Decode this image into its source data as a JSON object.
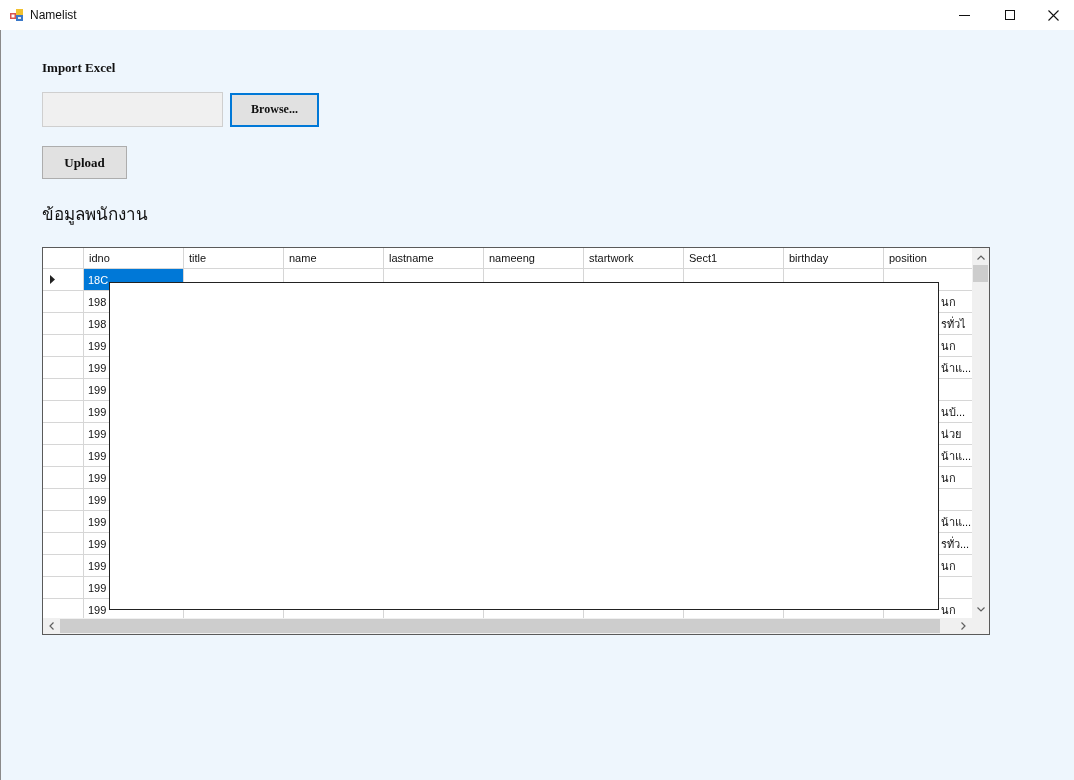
{
  "window": {
    "title": "Namelist"
  },
  "form": {
    "label": "Import Excel",
    "browse_button": {
      "label": "Browse...",
      "focused": true
    },
    "upload_button": "Upload",
    "section_title": "ข้อมูลพนักงาน"
  },
  "table": {
    "columns": [
      "idno",
      "title",
      "name",
      "lastname",
      "nameeng",
      "startwork",
      "Sect1",
      "birthday",
      "position"
    ],
    "rows": [
      {
        "selected": true,
        "cells": [
          "18C",
          null,
          null,
          null,
          null,
          null,
          null,
          null,
          null
        ]
      },
      {
        "selected": false,
        "cells": [
          "198",
          null,
          null,
          null,
          null,
          null,
          null,
          null,
          "นก"
        ]
      },
      {
        "selected": false,
        "cells": [
          "198",
          null,
          null,
          null,
          null,
          null,
          null,
          null,
          "รทั่วไ"
        ]
      },
      {
        "selected": false,
        "cells": [
          "199",
          null,
          null,
          null,
          null,
          null,
          null,
          null,
          "นก"
        ]
      },
      {
        "selected": false,
        "cells": [
          "199",
          null,
          null,
          null,
          null,
          null,
          null,
          null,
          "น้าแ..."
        ]
      },
      {
        "selected": false,
        "cells": [
          "199",
          null,
          null,
          null,
          null,
          null,
          null,
          null,
          null
        ]
      },
      {
        "selected": false,
        "cells": [
          "199",
          null,
          null,
          null,
          null,
          null,
          null,
          null,
          "นบ้..."
        ]
      },
      {
        "selected": false,
        "cells": [
          "199",
          null,
          null,
          null,
          null,
          null,
          null,
          null,
          "น่วย"
        ]
      },
      {
        "selected": false,
        "cells": [
          "199",
          null,
          null,
          null,
          null,
          null,
          null,
          null,
          "น้าแ..."
        ]
      },
      {
        "selected": false,
        "cells": [
          "199",
          null,
          null,
          null,
          null,
          null,
          null,
          null,
          "นก"
        ]
      },
      {
        "selected": false,
        "cells": [
          "199",
          null,
          null,
          null,
          null,
          null,
          null,
          null,
          null
        ]
      },
      {
        "selected": false,
        "cells": [
          "199",
          null,
          null,
          null,
          null,
          null,
          null,
          null,
          "น้าแ..."
        ]
      },
      {
        "selected": false,
        "cells": [
          "199",
          null,
          null,
          null,
          null,
          null,
          null,
          null,
          "รทั่ว..."
        ]
      },
      {
        "selected": false,
        "cells": [
          "199",
          null,
          null,
          null,
          null,
          null,
          null,
          null,
          "นก"
        ]
      },
      {
        "selected": false,
        "cells": [
          "199",
          null,
          null,
          null,
          null,
          null,
          null,
          null,
          null
        ]
      },
      {
        "selected": false,
        "cells": [
          "199",
          null,
          null,
          null,
          null,
          null,
          null,
          null,
          "นก"
        ]
      }
    ]
  }
}
